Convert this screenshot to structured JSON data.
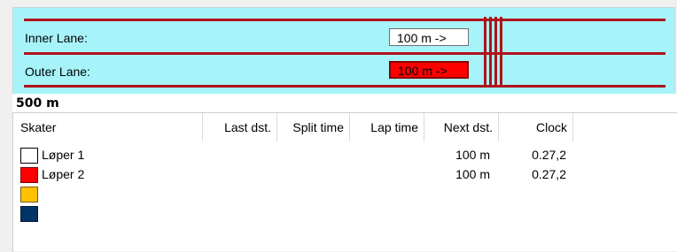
{
  "lanes": {
    "inner": {
      "label": "Inner Lane:",
      "value": "100 m  ->"
    },
    "outer": {
      "label": "Outer Lane:",
      "value": "100 m  ->",
      "highlight_color": "#ff0000"
    }
  },
  "distance": "500 m",
  "table": {
    "headers": [
      "Skater",
      "Last dst.",
      "Split time",
      "Lap time",
      "Next dst.",
      "Clock"
    ],
    "rows": [
      {
        "swatch_color": "#ffffff",
        "name": "Løper 1",
        "last_dst": "",
        "split_time": "",
        "lap_time": "",
        "next_dst": "100 m",
        "clock": "0.27,2"
      },
      {
        "swatch_color": "#ff0000",
        "name": "Løper 2",
        "last_dst": "",
        "split_time": "",
        "lap_time": "",
        "next_dst": "100 m",
        "clock": "0.27,2"
      },
      {
        "swatch_color": "#ffc000",
        "name": "",
        "last_dst": "",
        "split_time": "",
        "lap_time": "",
        "next_dst": "",
        "clock": ""
      },
      {
        "swatch_color": "#003366",
        "name": "",
        "last_dst": "",
        "split_time": "",
        "lap_time": "",
        "next_dst": "",
        "clock": ""
      }
    ]
  }
}
